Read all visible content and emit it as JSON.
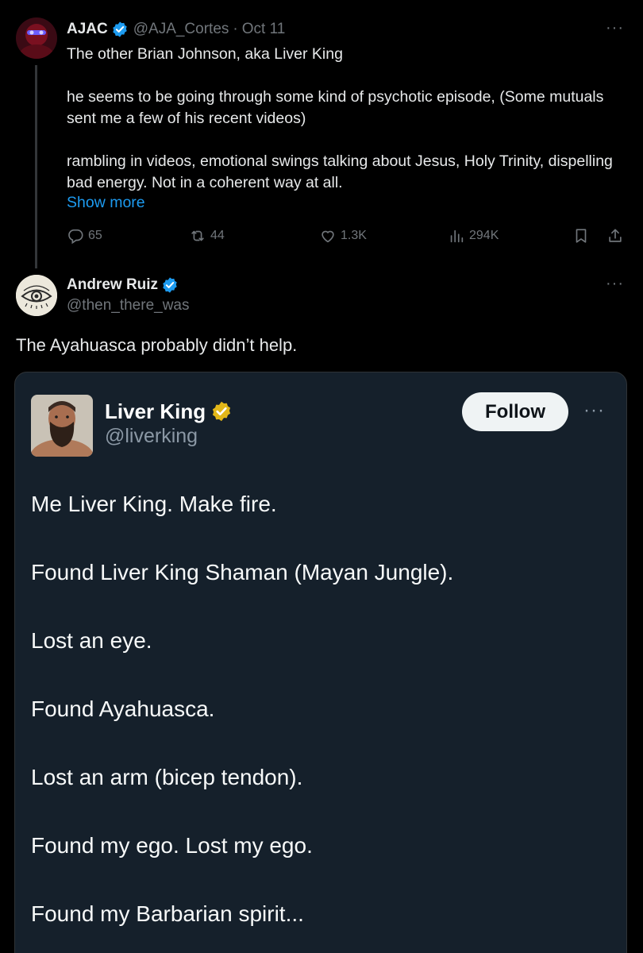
{
  "tweet1": {
    "name": "AJAC",
    "handle": "@AJA_Cortes",
    "separator": "·",
    "date": "Oct 11",
    "more": "···",
    "paragraphs": [
      "The other Brian Johnson, aka Liver King",
      "he seems to be going through some kind of psychotic episode, (Some mutuals sent me a few of his recent videos)",
      "rambling in videos, emotional swings talking about Jesus, Holy Trinity, dispelling bad energy. Not in a coherent way at all."
    ],
    "show_more": "Show more",
    "actions": {
      "replies": "65",
      "reposts": "44",
      "likes": "1.3K",
      "views": "294K"
    },
    "icons": [
      "reply-icon",
      "repost-icon",
      "like-icon",
      "views-icon",
      "bookmark-icon",
      "share-icon"
    ]
  },
  "tweet2": {
    "name": "Andrew Ruiz",
    "handle": "@then_there_was",
    "more": "···",
    "text": "The Ayahuasca probably didn’t help."
  },
  "embed": {
    "name": "Liver King",
    "handle": "@liverking",
    "follow_label": "Follow",
    "more": "···",
    "lines": [
      "Me Liver King. Make fire.",
      "Found Liver King Shaman (Mayan Jungle).",
      "Lost an eye.",
      "Found Ayahuasca.",
      "Lost an arm (bicep tendon).",
      "Found my ego. Lost my ego.",
      "Found my Barbarian spirit..."
    ]
  },
  "colors": {
    "background": "#000000",
    "card_background": "#15202b",
    "link": "#1d9bf0",
    "muted": "#71767b",
    "verified_blue": "#1d9bf0",
    "verified_gold": "#e2b719"
  }
}
